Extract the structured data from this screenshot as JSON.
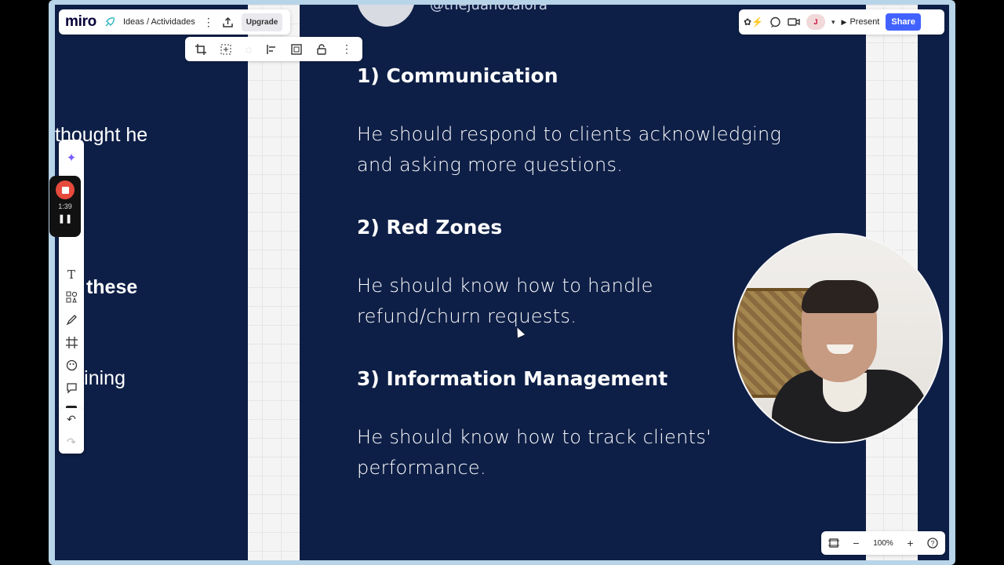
{
  "app": {
    "logo": "miro",
    "board_name": "Ideas / Actividades",
    "upgrade_label": "Upgrade"
  },
  "right_bar": {
    "user_initial": "J",
    "present_label": "Present",
    "share_label": "Share"
  },
  "recorder": {
    "time": "1:39"
  },
  "zoom": {
    "level": "100%"
  },
  "slide_left": {
    "line1": "thought he",
    "line2": "or these",
    "line3": "training"
  },
  "slide_main": {
    "handle": "@thejuanotalora",
    "sections": [
      {
        "heading": "1) Communication",
        "text": "He should respond to clients acknowledging and asking more questions."
      },
      {
        "heading": "2) Red Zones",
        "text": "He should know how to handle refund/churn requests."
      },
      {
        "heading": "3) Information Management",
        "text": "He should know how to track clients' performance."
      }
    ]
  },
  "colors": {
    "slide_bg": "#0e1f47",
    "share": "#4262ff",
    "record": "#e64a3c"
  },
  "icons": {
    "context_toolbar": [
      "crop-icon",
      "fit-icon",
      "loading-icon",
      "align-icon",
      "frame-icon",
      "lock-icon",
      "more-icon"
    ],
    "left_toolbar": [
      "ai-sparkle-icon",
      "text-icon",
      "shapes-icon",
      "pen-icon",
      "frame-icon",
      "sticker-icon",
      "comment-icon",
      "add-icon"
    ]
  }
}
